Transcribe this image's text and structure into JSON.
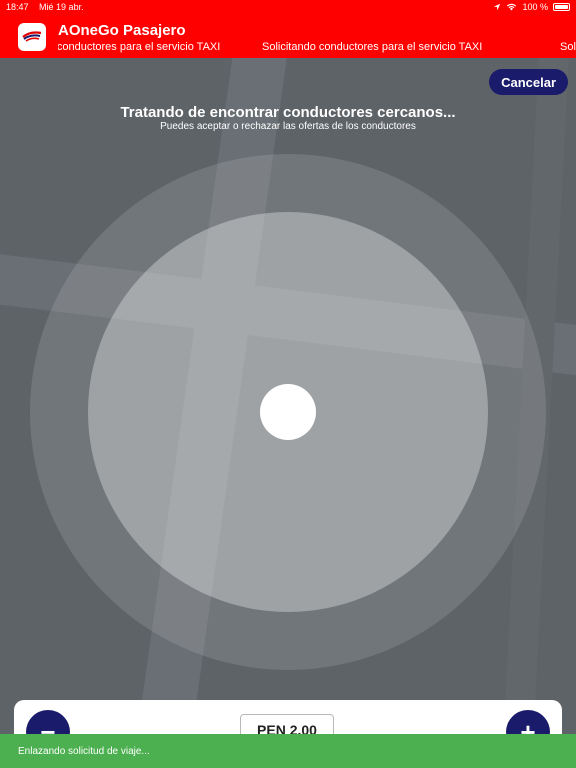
{
  "status_bar": {
    "time": "18:47",
    "date": "Mié 19 abr.",
    "battery": "100 %"
  },
  "header": {
    "title": "AOneGo Pasajero",
    "marquee_text": "Solicitando conductores para el servicio TAXI",
    "logo_icon": "aonego-logo-icon",
    "background_color": "#ff0000"
  },
  "search": {
    "cancel_label": "Cancelar",
    "title": "Tratando de encontrar conductores cercanos...",
    "subtitle": "Puedes aceptar o rechazar las ofertas de los conductores"
  },
  "fare": {
    "minus_label": "−",
    "plus_label": "+",
    "value": "PEN 2.00",
    "accent_color": "#1a1b6b"
  },
  "toast": {
    "message": "Enlazando solicitud de viaje...",
    "color": "#4caf50"
  }
}
